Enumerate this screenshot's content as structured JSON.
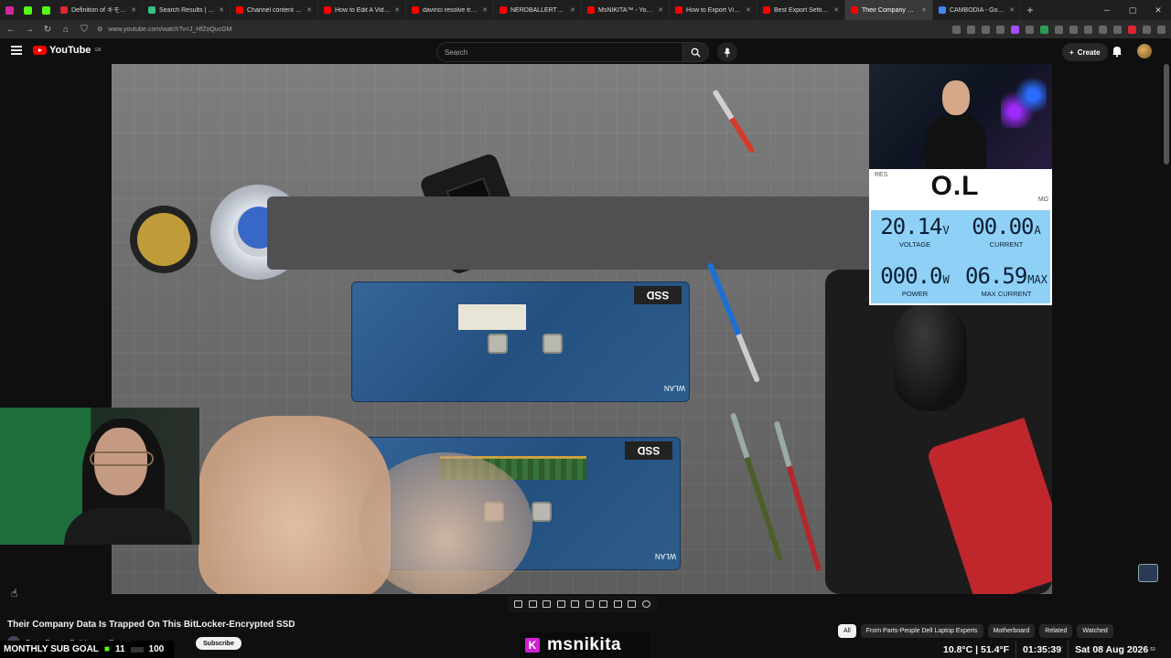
{
  "browser": {
    "tabs": [
      {
        "title": "Definition of キモい - Jap",
        "color": "#e0262f"
      },
      {
        "title": "Search Results | Trainline",
        "color": "#3ac080"
      },
      {
        "title": "Channel content - YouTube",
        "color": "#ff0000"
      },
      {
        "title": "How to Edit A Video in D",
        "color": "#ff0000"
      },
      {
        "title": "davinci resolve track, rem",
        "color": "#ff0000"
      },
      {
        "title": "NERDBALLERTV - YouTube",
        "color": "#ff0000"
      },
      {
        "title": "MsNIKITA™ - YouTube",
        "color": "#ff0000"
      },
      {
        "title": "How to Export Videos wit",
        "color": "#ff0000"
      },
      {
        "title": "Best Export Settings in Da",
        "color": "#ff0000"
      },
      {
        "title": "Their Company Data Is Tr",
        "color": "#ff0000",
        "active": true
      },
      {
        "title": "CAMBODIA - Google Sea",
        "color": "#4285f4"
      }
    ],
    "url": "www.youtube.com/watch?v=J_HfZoQucGM"
  },
  "youtube": {
    "logo_text": "YouTube",
    "logo_region": "GB",
    "search_placeholder": "Search",
    "create_label": "Create"
  },
  "overlays": {
    "dmm": {
      "mode": "RES",
      "reading": "O.L",
      "unit": "MΩ"
    },
    "psu": {
      "voltage": "20.14",
      "voltage_unit": "V",
      "voltage_label": "VOLTAGE",
      "current": "00.00",
      "current_unit": "A",
      "current_label": "CURRENT",
      "power": "000.0",
      "power_unit": "W",
      "power_label": "POWER",
      "max_current": "06.59",
      "max_current_unit": "MAX",
      "max_current_label": "MAX CURRENT"
    },
    "board_labels": {
      "ssd": "SSD",
      "wlan": "WLAN"
    }
  },
  "video": {
    "title": "Their Company Data Is Trapped On This BitLocker-Encrypted SSD",
    "channel": "Parts-People Dell Laptop Experts",
    "subscribe_label": "Subscribe"
  },
  "chips": [
    "All",
    "From Parts-People Dell Laptop Experts",
    "Motherboard",
    "Related",
    "Watched"
  ],
  "stream": {
    "sub_goal_label": "MONTHLY SUB GOAL",
    "sub_goal_current": "11",
    "sub_goal_target": "100",
    "streamer": "msnikita",
    "temperature": "10.8°C | 51.4°F",
    "time": "01:35:39",
    "date": "Sat 08 Aug 2026",
    "seconds": "53"
  }
}
